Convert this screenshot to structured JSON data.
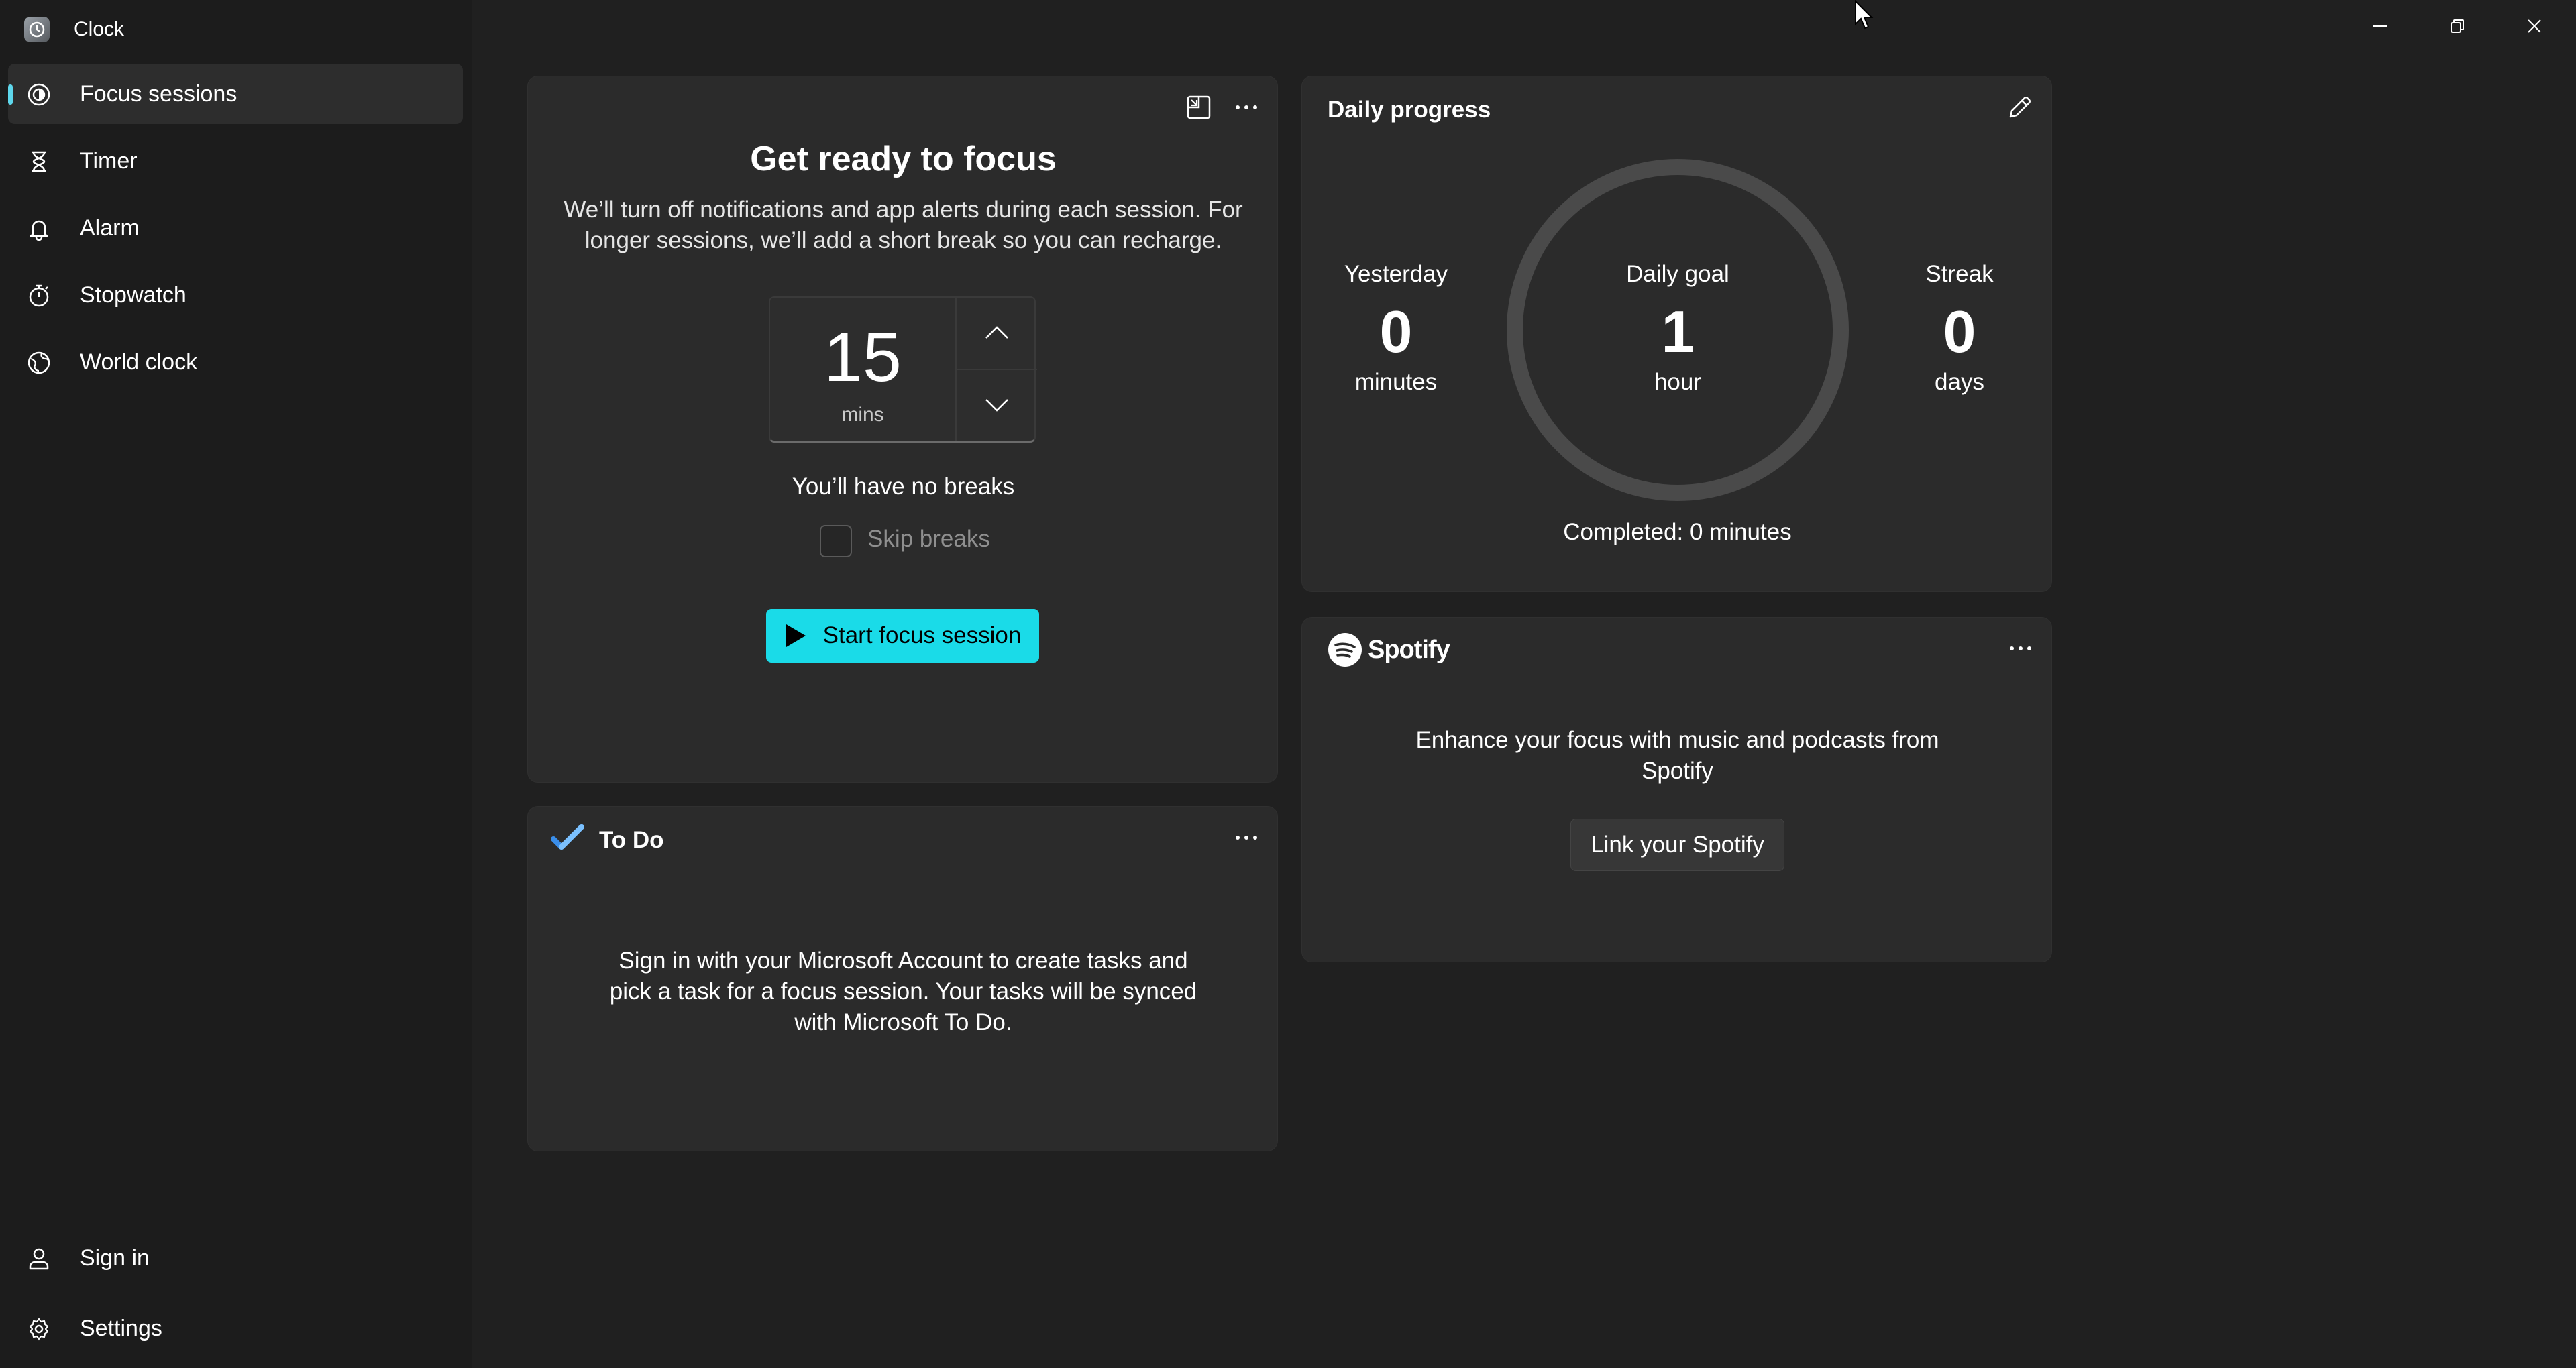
{
  "app": {
    "title": "Clock"
  },
  "sidebar": {
    "items": [
      {
        "label": "Focus sessions",
        "icon": "focus-icon",
        "active": true
      },
      {
        "label": "Timer",
        "icon": "hourglass-icon"
      },
      {
        "label": "Alarm",
        "icon": "bell-icon"
      },
      {
        "label": "Stopwatch",
        "icon": "stopwatch-icon"
      },
      {
        "label": "World clock",
        "icon": "globe-icon"
      }
    ],
    "bottom": [
      {
        "label": "Sign in",
        "icon": "person-icon"
      },
      {
        "label": "Settings",
        "icon": "gear-icon"
      }
    ]
  },
  "focus": {
    "title": "Get ready to focus",
    "description_line1": "We’ll turn off notifications and app alerts during each session. For",
    "description_line2": "longer sessions, we’ll add a short break so you can recharge.",
    "duration_value": "15",
    "duration_unit": "mins",
    "breaks_text": "You’ll have no breaks",
    "skip_breaks_label": "Skip breaks",
    "skip_breaks_checked": false,
    "start_label": "Start focus session"
  },
  "daily_progress": {
    "title": "Daily progress",
    "yesterday": {
      "label": "Yesterday",
      "value": "0",
      "unit": "minutes"
    },
    "goal": {
      "label": "Daily goal",
      "value": "1",
      "unit": "hour"
    },
    "streak": {
      "label": "Streak",
      "value": "0",
      "unit": "days"
    },
    "completed_text": "Completed: 0 minutes",
    "progress_fraction": 0
  },
  "spotify": {
    "brand": "Spotify",
    "description_line1": "Enhance your focus with music and podcasts from",
    "description_line2": "Spotify",
    "link_label": "Link your Spotify"
  },
  "todo": {
    "title": "To Do",
    "line1": "Sign in with your Microsoft Account to create tasks and",
    "line2": "pick a task for a focus session. Your tasks will be synced",
    "line3": "with Microsoft To Do."
  },
  "colors": {
    "accent": "#1adbe8",
    "nav_indicator": "#5ed7ec",
    "background": "#202020",
    "sidebar": "#1c1c1c",
    "card": "#2b2b2b",
    "ring": "#4a4a4a"
  }
}
